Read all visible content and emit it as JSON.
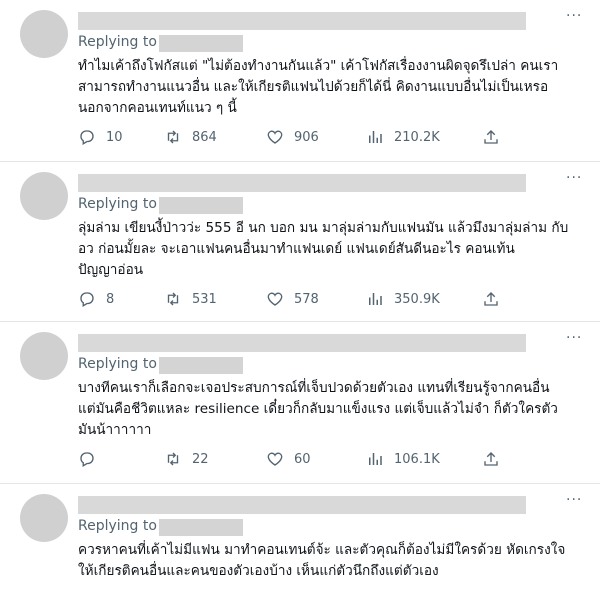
{
  "tweets": [
    {
      "replying_label": "Replying to",
      "more": "···",
      "lines": [
        "ทำไมเค้าถึงโฟกัสแต่ \"ไม่ต้องทำงานกันแล้ว\" เค้าโฟกัสเรื่องงานผิดจุดรึเปล่า คนเรา",
        "สามารถทำงานแนวอื่น และให้เกียรติแฟนไปด้วยก็ได้นี่ คิดงานแบบอื่นไม่เป็นเหรอ",
        "นอกจากคอนเทนท์แนว ๆ นี้"
      ],
      "replies": "10",
      "retweets": "864",
      "likes": "906",
      "views": "210.2K"
    },
    {
      "replying_label": "Replying to",
      "more": "···",
      "lines": [
        "ลุ่มล่าม เขียนงี้ป่าวว่ะ 555 อี นก บอก มน มาลุ่มล่ามกับแฟนมัน แล้วมึงมาลุ่มล่าม กับ",
        "อว ก่อนมั้ยละ จะเอาแฟนคนอื่นมาทำแฟนเดย์ แฟนเดย์สันดีนอะไร คอนเท้น",
        "ปัญญาอ่อน"
      ],
      "replies": "8",
      "retweets": "531",
      "likes": "578",
      "views": "350.9K"
    },
    {
      "replying_label": "Replying to",
      "more": "···",
      "lines": [
        "บางทีคนเราก็เลือกจะเจอประสบการณ์ที่เจ็บปวดด้วยตัวเอง แทนที่เรียนรู้จากคนอื่น",
        "แต่มันคือชีวิตแหละ resilience เดี๋ยวก็กลับมาแข็งแรง แต่เจ็บแล้วไม่จำ ก็ตัวใครตัว",
        "มันน้าาาาาา"
      ],
      "replies": "",
      "retweets": "22",
      "likes": "60",
      "views": "106.1K"
    },
    {
      "replying_label": "Replying to",
      "more": "···",
      "lines": [
        "ควรหาคนที่เค้าไม่มีแฟน มาทำคอนเทนต์จ้ะ และตัวคุณก็ต้องไม่มีใครด้วย หัดเกรงใจ",
        "ให้เกียรติคนอื่นและคนของตัวเองบ้าง เห็นแก่ตัวนึกถึงแต่ตัวเอง"
      ]
    }
  ],
  "icons": {
    "reply": "reply-icon",
    "retweet": "retweet-icon",
    "like": "heart-icon",
    "views": "views-icon",
    "share": "share-icon",
    "more": "more-icon"
  },
  "colors": {
    "text": "#0f1419",
    "muted": "#536471",
    "placeholder": "#d9d9d9",
    "divider": "#e6e6e6"
  }
}
